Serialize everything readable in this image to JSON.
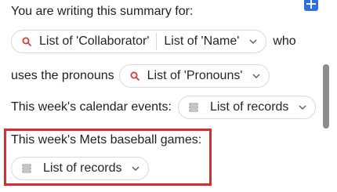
{
  "intro_text": "You are writing this summary for:",
  "collaborator_pill": {
    "left_label": "List of 'Collaborator'",
    "right_label": "List of 'Name'"
  },
  "who_text": "who",
  "pronouns_prefix": "uses the pronouns",
  "pronouns_pill": {
    "label": "List of 'Pronouns'"
  },
  "calendar_label": "This week's calendar events:",
  "calendar_pill": {
    "label": "List of records"
  },
  "mets_label": "This week's Mets baseball games:",
  "mets_pill": {
    "label": "List of records"
  },
  "colors": {
    "highlight": "#d32f2f",
    "search_icon": "#d23b3b",
    "plus_button": "#2f6fe4"
  }
}
